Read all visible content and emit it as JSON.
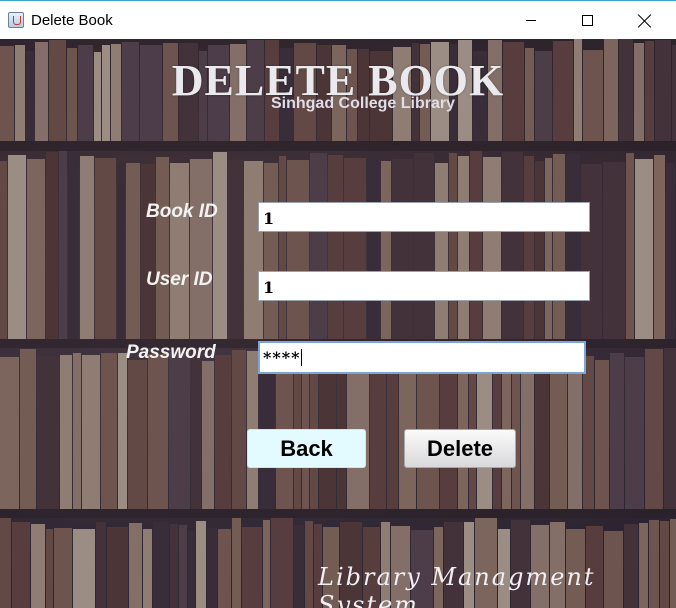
{
  "window": {
    "title": "Delete Book"
  },
  "form": {
    "heading": "DELETE BOOK",
    "subheading": "Sinhgad College Library",
    "book_id_label": "Book ID",
    "book_id_value": "1",
    "user_id_label": "User ID",
    "user_id_value": "1",
    "password_label": "Password",
    "password_value": "****"
  },
  "buttons": {
    "back_label": "Back",
    "delete_label": "Delete"
  },
  "footer": {
    "tagline": "Library Managment System"
  },
  "colors": {
    "back_button_bg": "#e3fbff",
    "label_text": "#f2f2f2",
    "focus_border": "#7aa7d6"
  },
  "icons": [
    "java-app-icon",
    "minimize-icon",
    "maximize-icon",
    "close-icon"
  ]
}
